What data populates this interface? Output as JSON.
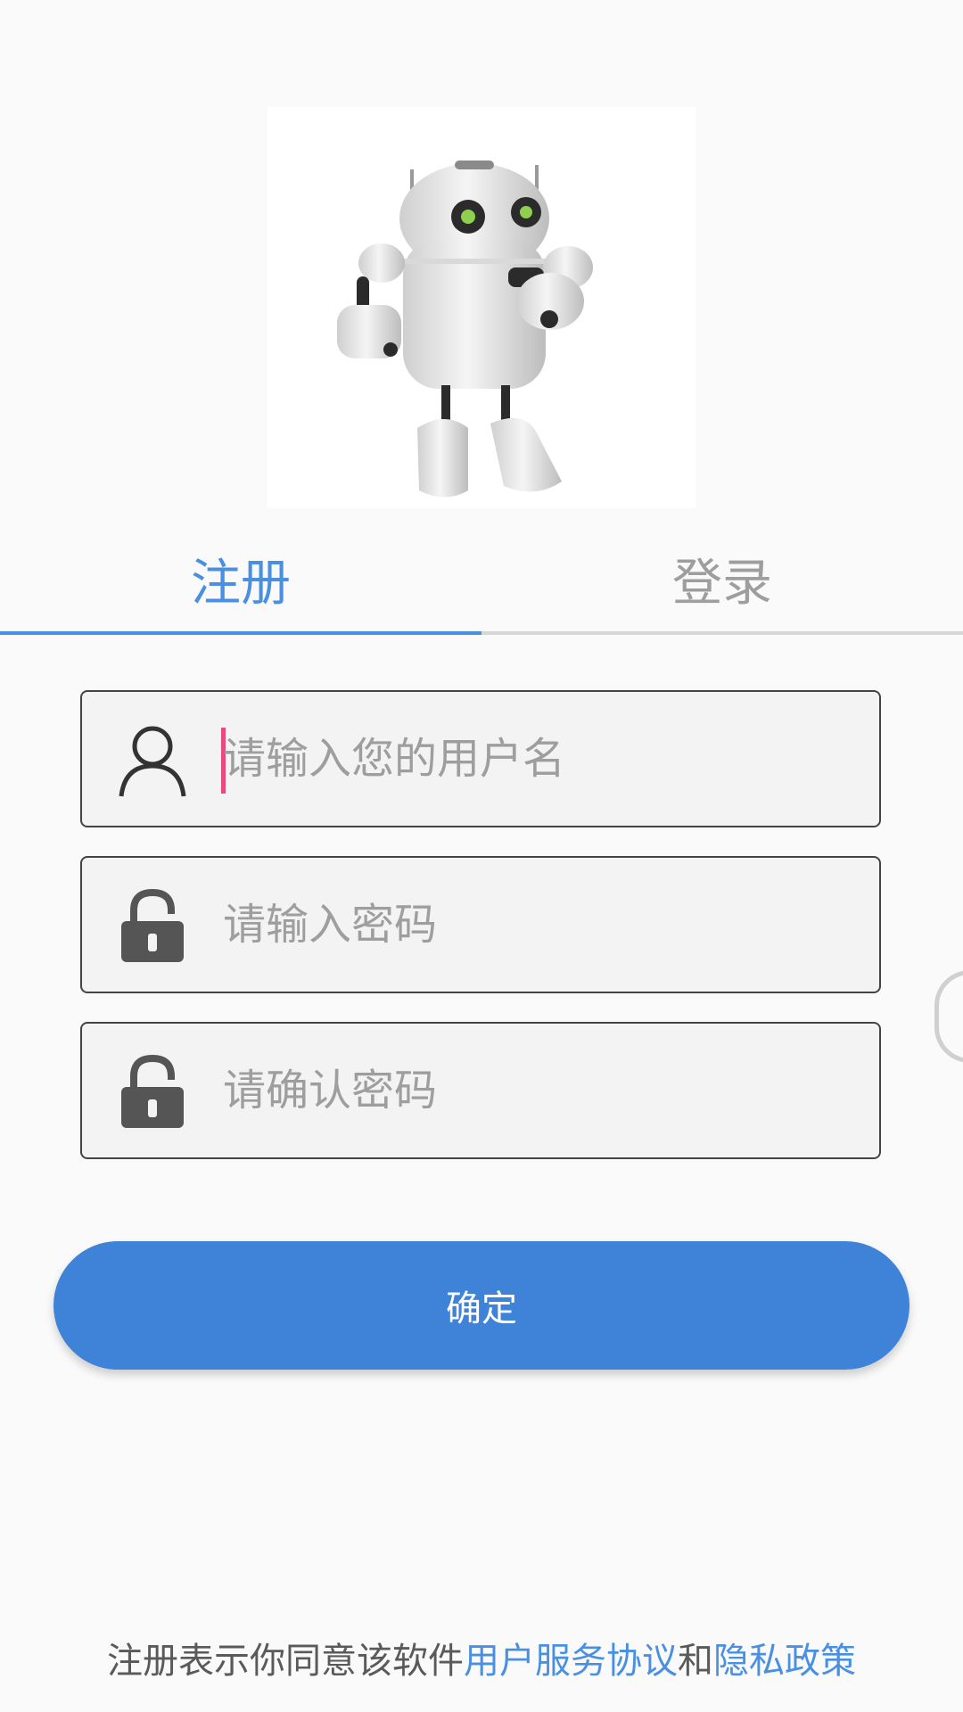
{
  "tabs": {
    "register": "注册",
    "login": "登录",
    "active": "register"
  },
  "form": {
    "username_placeholder": "请输入您的用户名",
    "password_placeholder": "请输入密码",
    "confirm_placeholder": "请确认密码",
    "submit_label": "确定"
  },
  "icons": {
    "username": "user-icon",
    "password": "lock-icon",
    "confirm": "lock-icon"
  },
  "agreement": {
    "prefix": "注册表示你同意该软件",
    "terms_link": "用户服务协议",
    "and": "和",
    "privacy_link": "隐私政策"
  },
  "colors": {
    "accent": "#4a90e2",
    "button": "#3e83d7",
    "caret": "#e94a7d",
    "inactive_tab": "#9e9e9e"
  }
}
